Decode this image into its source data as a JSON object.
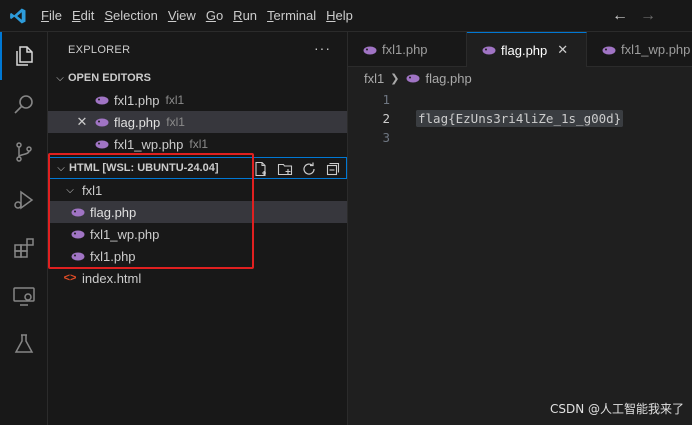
{
  "titlebar": {
    "menu": [
      {
        "label": "File",
        "mnemonic": "F",
        "rest": "ile"
      },
      {
        "label": "Edit",
        "mnemonic": "E",
        "rest": "dit"
      },
      {
        "label": "Selection",
        "mnemonic": "S",
        "rest": "election"
      },
      {
        "label": "View",
        "mnemonic": "V",
        "rest": "iew"
      },
      {
        "label": "Go",
        "mnemonic": "G",
        "rest": "o"
      },
      {
        "label": "Run",
        "mnemonic": "R",
        "rest": "un"
      },
      {
        "label": "Terminal",
        "mnemonic": "T",
        "rest": "erminal"
      },
      {
        "label": "Help",
        "mnemonic": "H",
        "rest": "elp"
      }
    ],
    "back_icon": "←",
    "forward_icon": "→"
  },
  "activitybar": {
    "items": [
      "explorer-icon",
      "search-icon",
      "source-control-icon",
      "run-debug-icon",
      "extensions-icon",
      "remote-explorer-icon",
      "testing-icon"
    ]
  },
  "sidebar": {
    "title": "EXPLORER",
    "more": "···",
    "open_editors": {
      "title": "OPEN EDITORS",
      "items": [
        {
          "name": "fxl1.php",
          "desc": "fxl1"
        },
        {
          "name": "flag.php",
          "desc": "fxl1"
        },
        {
          "name": "fxl1_wp.php",
          "desc": "fxl1"
        }
      ]
    },
    "workspace": {
      "title": "HTML [WSL: UBUNTU-24.04]",
      "folder": "fxl1",
      "files": [
        "flag.php",
        "fxl1_wp.php",
        "fxl1.php"
      ],
      "root_file": "index.html"
    }
  },
  "editor": {
    "tabs": [
      {
        "name": "fxl1.php"
      },
      {
        "name": "flag.php"
      },
      {
        "name": "fxl1_wp.php"
      }
    ],
    "breadcrumb": {
      "folder": "fxl1",
      "file": "flag.php"
    },
    "lines": [
      {
        "number": "1",
        "text": ""
      },
      {
        "number": "2",
        "text": "flag{EzUns3ri4liZe_1s_g00d}"
      },
      {
        "number": "3",
        "text": ""
      }
    ]
  },
  "watermark": "CSDN @人工智能我来了",
  "colors": {
    "accent": "#0078d4",
    "php_icon": "#a074c4",
    "html_icon": "#e44d26",
    "annotation": "#e02020"
  }
}
